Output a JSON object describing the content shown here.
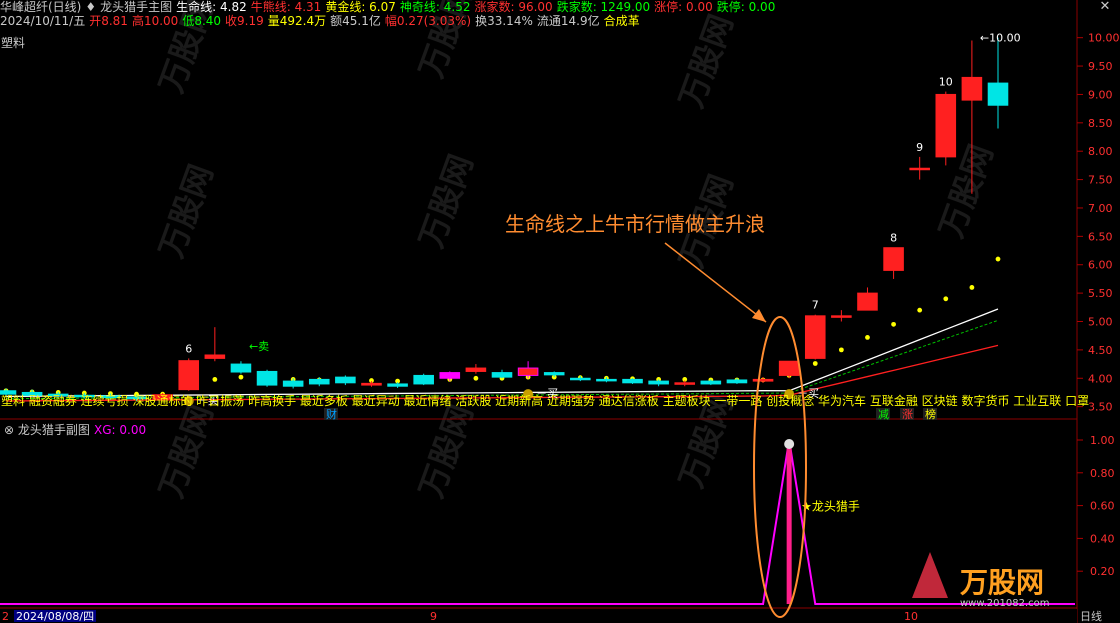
{
  "window": {
    "app_title": "华峰超纤(日线)",
    "close_glyph": "✕"
  },
  "main_chart": {
    "formula_name": "龙头猎手主图",
    "indicators": [
      {
        "label": "生命线:",
        "value": "4.82",
        "color": "#ffffff"
      },
      {
        "label": "牛熊线:",
        "value": "4.31",
        "color": "#ff3030"
      },
      {
        "label": "黄金线:",
        "value": "6.07",
        "color": "#ffff00"
      },
      {
        "label": "神奇线:",
        "value": "4.52",
        "color": "#00ff00"
      },
      {
        "label": "涨家数:",
        "value": "96.00",
        "color": "#ff3030"
      },
      {
        "label": "跌家数:",
        "value": "1249.00",
        "color": "#00ff00"
      },
      {
        "label": "涨停:",
        "value": "0.00",
        "color": "#ff3030"
      },
      {
        "label": "跌停:",
        "value": "0.00",
        "color": "#00ff00"
      }
    ],
    "quote": [
      {
        "text": "2024/10/11/五",
        "color": "#c8c8c8"
      },
      {
        "text": "开8.81",
        "color": "#ff3030"
      },
      {
        "text": "高10.00",
        "color": "#ff3030"
      },
      {
        "text": "低8.40",
        "color": "#00ff00"
      },
      {
        "text": "收9.19",
        "color": "#ff3030"
      },
      {
        "text": "量492.4万",
        "color": "#ffff00"
      },
      {
        "text": "额45.1亿",
        "color": "#c8c8c8"
      },
      {
        "text": "幅0.27(3.03%)",
        "color": "#ff3030"
      },
      {
        "text": "换33.14%",
        "color": "#c8c8c8"
      },
      {
        "text": "流通14.9亿",
        "color": "#c8c8c8"
      },
      {
        "text": "合成革",
        "color": "#ffff00"
      }
    ],
    "sector_label": "塑料",
    "annotation": "生命线之上牛市行情做主升浪",
    "high_marker": "10.00",
    "candle_labels": [
      "6",
      "7",
      "8",
      "9",
      "10"
    ],
    "signals": {
      "buy": "买",
      "sell": "卖",
      "sell_arrow": "←卖"
    },
    "concept_strip": "塑料 融资融券 连续亏损 深股通标的 昨日振荡 昨高换手 最近多板 最近异动 最近情绪 活跃股 近期新高 近期强势 通达信涨板 主题板块 一带一路 创投概念 华为汽车 互联金融 区块链 数字货币 工业互联 口罩",
    "event_tags": [
      {
        "text": "财",
        "color": "#00a0ff"
      },
      {
        "text": "减",
        "color": "#00ff00"
      },
      {
        "text": "涨",
        "color": "#ff3030"
      },
      {
        "text": "榜",
        "color": "#ffff00"
      }
    ]
  },
  "sub_chart": {
    "formula_name": "龙头猎手副图",
    "xg_label": "XG:",
    "xg_value": "0.00",
    "signal_label": "★龙头猎手"
  },
  "axis": {
    "main_ticks": [
      "10.00",
      "9.50",
      "9.00",
      "8.50",
      "8.00",
      "7.50",
      "7.00",
      "6.50",
      "6.00",
      "5.50",
      "5.00",
      "4.50",
      "4.00",
      "3.50"
    ],
    "sub_ticks": [
      "1.00",
      "0.80",
      "0.60",
      "0.40",
      "0.20"
    ],
    "date_label": "2024/08/08/四",
    "month_labels": [
      "2",
      "9",
      "10"
    ],
    "period": "日线"
  },
  "watermark": {
    "brand": "万股网",
    "url": "www.201082.com"
  },
  "chart_data": {
    "type": "candlestick",
    "ylim": [
      3.3,
      10.1
    ],
    "candles": [
      {
        "o": 3.78,
        "c": 3.72,
        "h": 3.82,
        "l": 3.68
      },
      {
        "o": 3.75,
        "c": 3.7,
        "h": 3.8,
        "l": 3.66
      },
      {
        "o": 3.72,
        "c": 3.69,
        "h": 3.76,
        "l": 3.65
      },
      {
        "o": 3.7,
        "c": 3.68,
        "h": 3.74,
        "l": 3.64
      },
      {
        "o": 3.69,
        "c": 3.66,
        "h": 3.73,
        "l": 3.62
      },
      {
        "o": 3.67,
        "c": 3.64,
        "h": 3.71,
        "l": 3.6
      },
      {
        "o": 3.62,
        "c": 3.71,
        "h": 3.74,
        "l": 3.6
      },
      {
        "o": 3.8,
        "c": 4.31,
        "h": 4.35,
        "l": 3.78
      },
      {
        "o": 4.35,
        "c": 4.41,
        "h": 4.9,
        "l": 4.3
      },
      {
        "o": 4.25,
        "c": 4.11,
        "h": 4.3,
        "l": 4.08
      },
      {
        "o": 4.12,
        "c": 3.88,
        "h": 4.15,
        "l": 3.85
      },
      {
        "o": 3.95,
        "c": 3.86,
        "h": 4.0,
        "l": 3.82
      },
      {
        "o": 3.98,
        "c": 3.9,
        "h": 4.02,
        "l": 3.86
      },
      {
        "o": 4.02,
        "c": 3.92,
        "h": 4.05,
        "l": 3.88
      },
      {
        "o": 3.88,
        "c": 3.91,
        "h": 3.95,
        "l": 3.85
      },
      {
        "o": 3.9,
        "c": 3.86,
        "h": 3.93,
        "l": 3.83
      },
      {
        "o": 4.05,
        "c": 3.9,
        "h": 4.08,
        "l": 3.88
      },
      {
        "o": 4.1,
        "c": 4.0,
        "h": 4.12,
        "l": 3.95
      },
      {
        "o": 4.12,
        "c": 4.18,
        "h": 4.25,
        "l": 4.08
      },
      {
        "o": 4.1,
        "c": 4.02,
        "h": 4.15,
        "l": 4.0
      },
      {
        "o": 4.05,
        "c": 4.18,
        "h": 4.3,
        "l": 4.0
      },
      {
        "o": 4.1,
        "c": 4.06,
        "h": 4.12,
        "l": 4.02
      },
      {
        "o": 4.0,
        "c": 3.98,
        "h": 4.04,
        "l": 3.95
      },
      {
        "o": 3.98,
        "c": 3.96,
        "h": 4.02,
        "l": 3.93
      },
      {
        "o": 3.98,
        "c": 3.92,
        "h": 4.0,
        "l": 3.9
      },
      {
        "o": 3.95,
        "c": 3.9,
        "h": 3.98,
        "l": 3.86
      },
      {
        "o": 3.9,
        "c": 3.92,
        "h": 3.96,
        "l": 3.86
      },
      {
        "o": 3.95,
        "c": 3.9,
        "h": 3.98,
        "l": 3.88
      },
      {
        "o": 3.97,
        "c": 3.92,
        "h": 4.0,
        "l": 3.9
      },
      {
        "o": 3.95,
        "c": 3.98,
        "h": 4.02,
        "l": 3.92
      },
      {
        "o": 4.05,
        "c": 4.3,
        "h": 4.3,
        "l": 4.0
      },
      {
        "o": 4.35,
        "c": 5.1,
        "h": 5.12,
        "l": 4.33
      },
      {
        "o": 5.1,
        "c": 5.1,
        "h": 5.2,
        "l": 5.0
      },
      {
        "o": 5.2,
        "c": 5.5,
        "h": 5.6,
        "l": 5.2
      },
      {
        "o": 5.9,
        "c": 6.3,
        "h": 6.3,
        "l": 5.75
      },
      {
        "o": 7.7,
        "c": 7.7,
        "h": 7.9,
        "l": 7.5
      },
      {
        "o": 7.9,
        "c": 9.0,
        "h": 9.05,
        "l": 7.75
      },
      {
        "o": 8.9,
        "c": 9.3,
        "h": 9.95,
        "l": 7.25
      },
      {
        "o": 9.2,
        "c": 8.81,
        "h": 10.0,
        "l": 8.4
      }
    ]
  }
}
